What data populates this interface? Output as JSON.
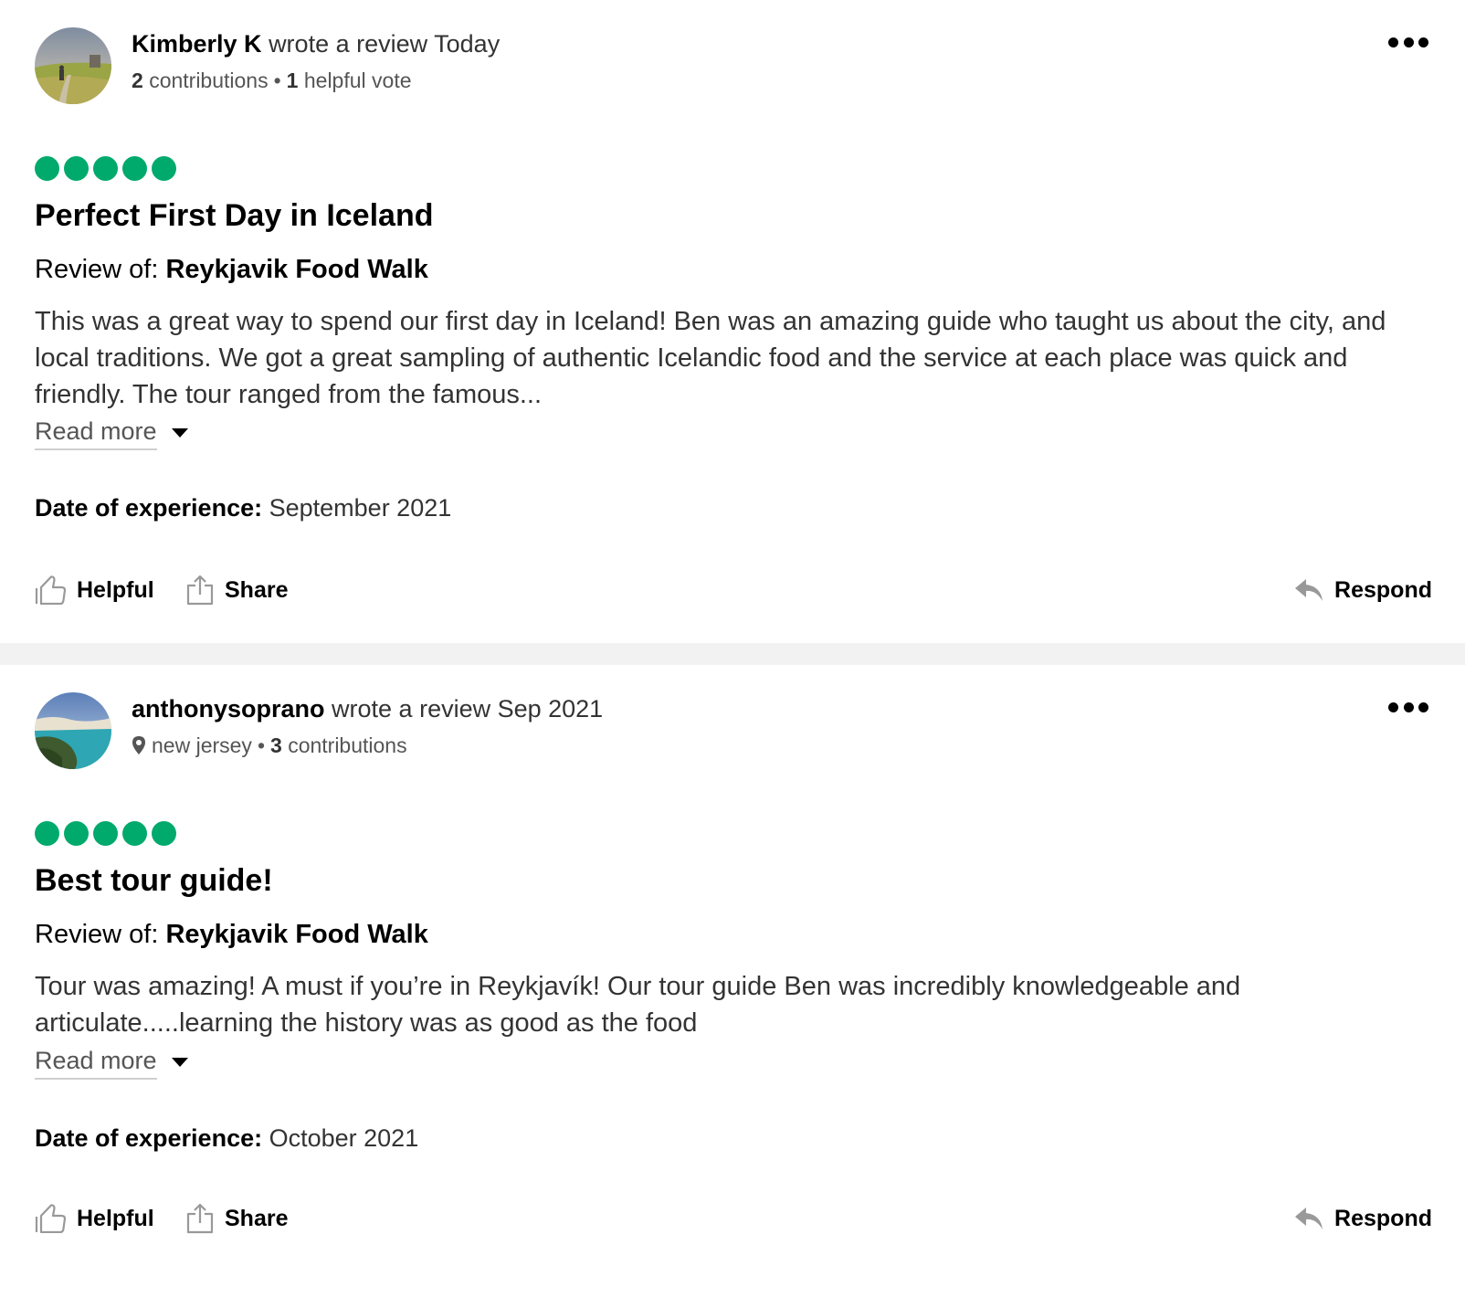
{
  "reviews": [
    {
      "author": "Kimberly K",
      "wrote_text": "wrote a review Today",
      "meta": {
        "location": "",
        "contributions_count": "2",
        "contributions_label": "contributions",
        "helpful_count": "1",
        "helpful_label": "helpful vote"
      },
      "rating": 5,
      "title": "Perfect First Day in Iceland",
      "review_of_label": "Review of:",
      "review_of_name": "Reykjavik Food Walk",
      "body": "This was a great way to spend our first day in Iceland! Ben was an amazing guide who taught us about the city, and local traditions. We got a great sampling of authentic Icelandic food and the service at each place was quick and friendly. The tour ranged from the famous...",
      "read_more": "Read more",
      "date_label": "Date of experience:",
      "date_value": "September 2021",
      "actions": {
        "helpful": "Helpful",
        "share": "Share",
        "respond": "Respond"
      }
    },
    {
      "author": "anthonysoprano",
      "wrote_text": "wrote a review Sep 2021",
      "meta": {
        "location": "new jersey",
        "contributions_count": "3",
        "contributions_label": "contributions"
      },
      "rating": 5,
      "title": "Best tour guide!",
      "review_of_label": "Review of:",
      "review_of_name": "Reykjavik Food Walk",
      "body": "Tour was amazing! A must if you’re in Reykjavík! Our tour guide Ben was incredibly knowledgeable and articulate.....learning the history was as good as the food",
      "read_more": "Read more",
      "date_label": "Date of experience:",
      "date_value": "October 2021",
      "actions": {
        "helpful": "Helpful",
        "share": "Share",
        "respond": "Respond"
      }
    }
  ],
  "colors": {
    "rating_bubble": "#00aa6c",
    "divider": "#f2f2f2"
  },
  "icons": [
    "more-options-icon",
    "thumbs-up-icon",
    "share-icon",
    "respond-arrow-icon",
    "location-pin-icon"
  ]
}
